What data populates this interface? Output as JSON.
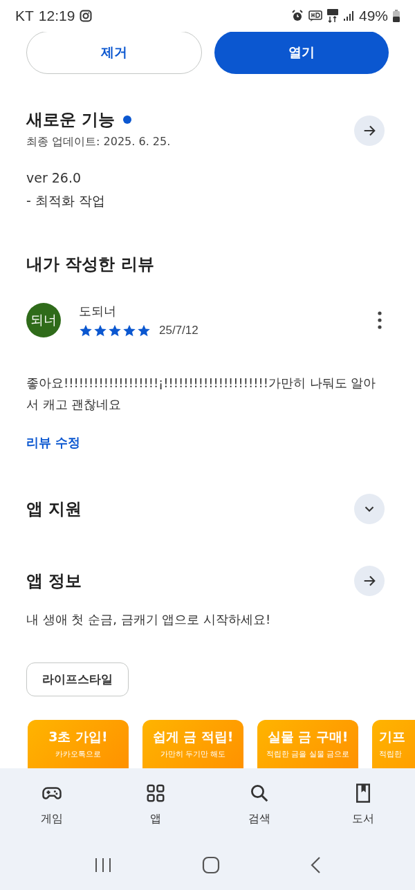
{
  "status_bar": {
    "carrier": "KT",
    "time": "12:19",
    "battery": "49%"
  },
  "actions": [
    {
      "label": "제거",
      "kind": "outline"
    },
    {
      "label": "열기",
      "kind": "filled"
    }
  ],
  "whats_new": {
    "title": "새로운 기능",
    "unread": true,
    "updated": "최종 업데이트: 2025. 6. 25.",
    "lines": [
      "ver 26.0",
      "- 최적화 작업"
    ]
  },
  "my_review": {
    "title": "내가 작성한 리뷰",
    "avatar": "되너",
    "author": "도되너",
    "stars": 5,
    "date": "25/7/12",
    "text": "좋아요!!!!!!!!!!!!!!!!!!!¡!!!!!!!!!!!!!!!!!!!!!가만히 나둬도 알아서 캐고 괜찮네요",
    "edit_link": "리뷰 수정"
  },
  "app_support": {
    "title": "앱 지원",
    "expanded": false
  },
  "app_info": {
    "title": "앱 정보",
    "description": "내 생애 첫 순금, 금캐기 앱으로 시작하세요!",
    "category": "라이프스타일"
  },
  "screenshots": [
    {
      "title": "3초 가입!",
      "caption": "카카오톡으로"
    },
    {
      "title": "쉽게 금 적립!",
      "caption": "가만히 두기만 해도"
    },
    {
      "title": "실물 금 구매!",
      "caption": "적립한 금을 실물 금으로"
    },
    {
      "title": "기프",
      "caption": "적립한",
      "kind": "partial"
    }
  ],
  "bottom_nav": [
    {
      "label": "게임",
      "selected": false
    },
    {
      "label": "앱",
      "selected": false
    },
    {
      "label": "검색",
      "selected": false
    },
    {
      "label": "도서",
      "selected": false
    }
  ]
}
